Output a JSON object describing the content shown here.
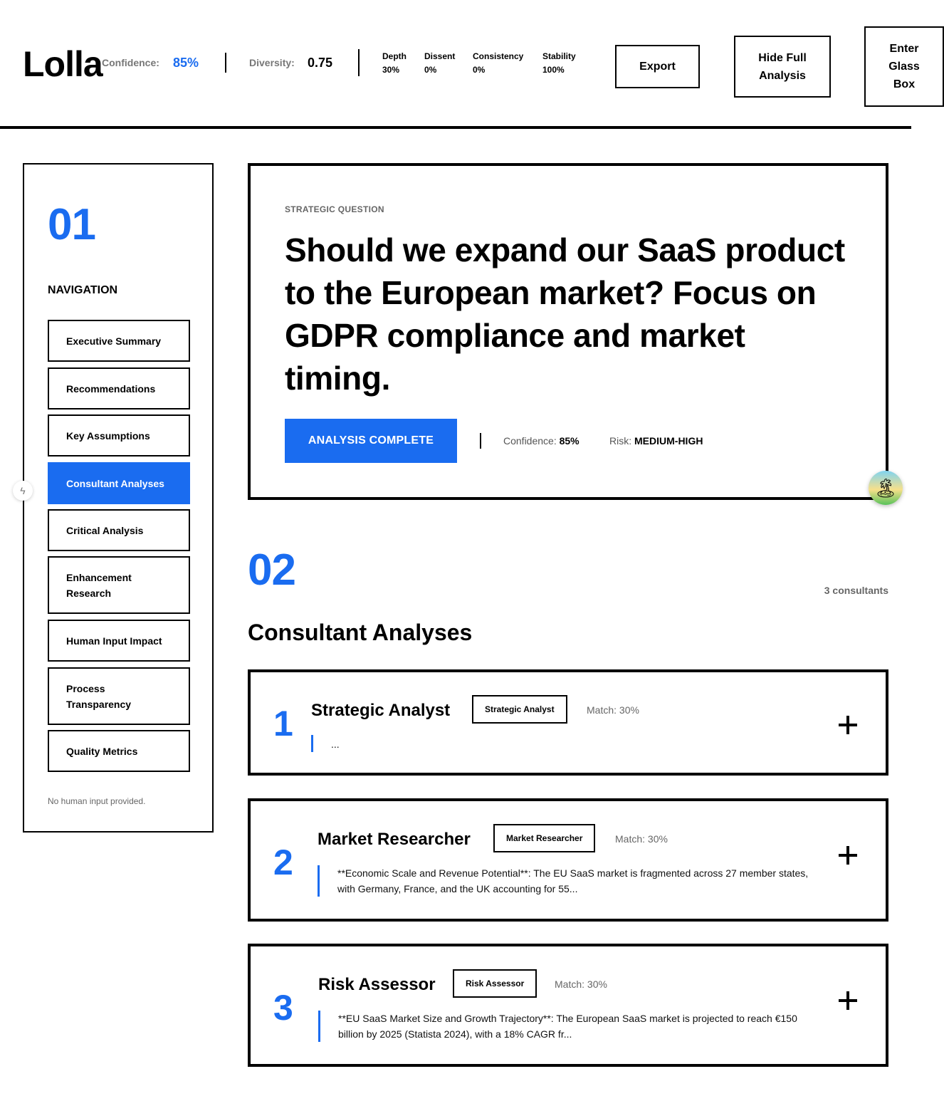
{
  "header": {
    "brand": "Lolla",
    "confidence_label": "Confidence:",
    "confidence_value": "85%",
    "diversity_label": "Diversity:",
    "diversity_value": "0.75",
    "metrics": [
      {
        "label": "Depth",
        "value": "30%"
      },
      {
        "label": "Dissent",
        "value": "0%"
      },
      {
        "label": "Consistency",
        "value": "0%"
      },
      {
        "label": "Stability",
        "value": "100%"
      }
    ],
    "export_label": "Export",
    "hide_label": "Hide Full Analysis",
    "glass_label": "Enter Glass Box"
  },
  "sidebar": {
    "number": "01",
    "title": "NAVIGATION",
    "items": [
      {
        "label": "Executive Summary",
        "active": false
      },
      {
        "label": "Recommendations",
        "active": false
      },
      {
        "label": "Key Assumptions",
        "active": false
      },
      {
        "label": "Consultant Analyses",
        "active": true
      },
      {
        "label": "Critical Analysis",
        "active": false
      },
      {
        "label": "Enhancement Research",
        "active": false
      },
      {
        "label": "Human Input Impact",
        "active": false
      },
      {
        "label": "Process Transparency",
        "active": false
      },
      {
        "label": "Quality Metrics",
        "active": false
      }
    ],
    "note": "No human input provided."
  },
  "question": {
    "eyebrow": "STRATEGIC QUESTION",
    "text": "Should we expand our SaaS product to the European market? Focus on GDPR compliance and market timing.",
    "status": "ANALYSIS COMPLETE",
    "confidence_label": "Confidence:",
    "confidence_value": "85%",
    "risk_label": "Risk:",
    "risk_value": "MEDIUM-HIGH"
  },
  "section": {
    "number": "02",
    "title": "Consultant Analyses",
    "count": "3 consultants"
  },
  "consultants": [
    {
      "index": "1",
      "name": "Strategic Analyst",
      "tag": "Strategic Analyst",
      "match": "Match: 30%",
      "summary": "..."
    },
    {
      "index": "2",
      "name": "Market Researcher",
      "tag": "Market Researcher",
      "match": "Match: 30%",
      "summary": "**Economic Scale and Revenue Potential**: The EU SaaS market is fragmented across 27 member states, with Germany, France, and the UK accounting for 55..."
    },
    {
      "index": "3",
      "name": "Risk Assessor",
      "tag": "Risk Assessor",
      "match": "Match: 30%",
      "summary": "**EU SaaS Market Size and Growth Trajectory**: The European SaaS market is projected to reach €150 billion by 2025 (Statista 2024), with a 18% CAGR fr..."
    }
  ],
  "colors": {
    "accent": "#1a6cf0",
    "border": "#000000"
  },
  "icons": {
    "avatar": "island-avatar-icon",
    "side_tab": "lightning-icon",
    "expand": "plus-icon"
  }
}
